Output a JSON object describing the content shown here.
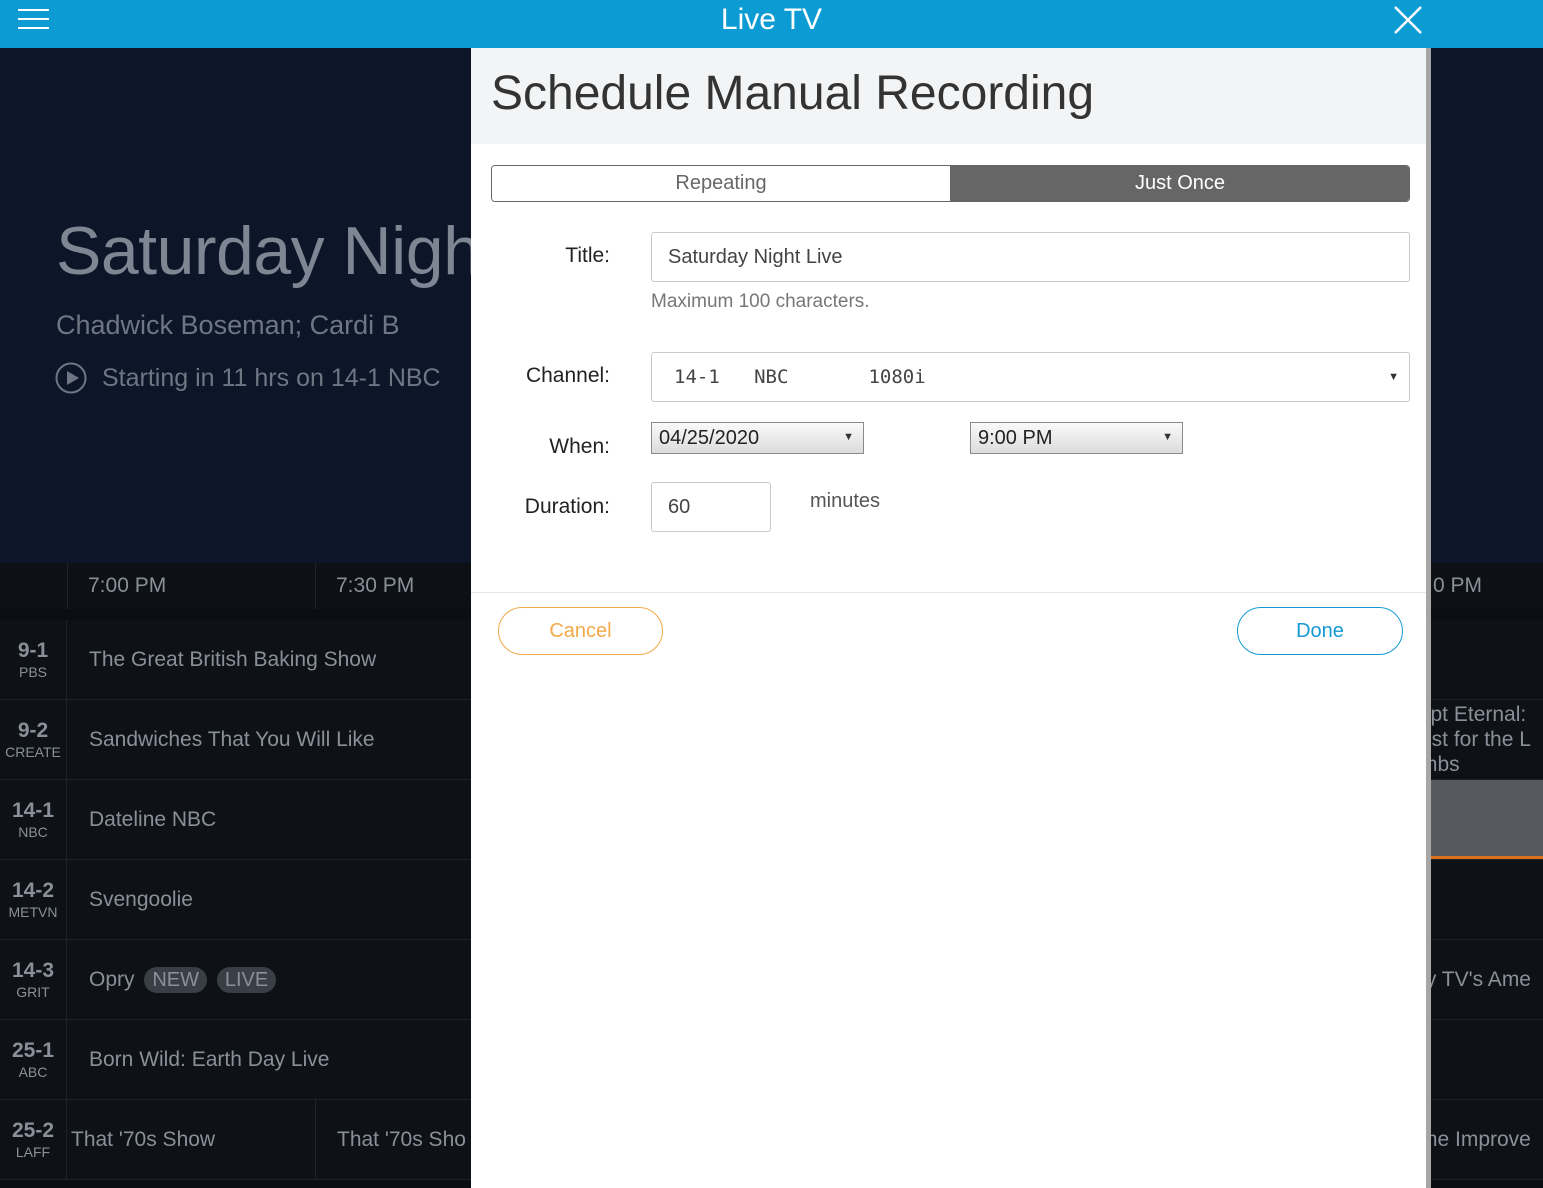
{
  "app": {
    "title": "Live TV"
  },
  "hero": {
    "title": "Saturday Nigh",
    "subtitle": "Chadwick Boseman; Cardi B",
    "status": "Starting in 11 hrs on 14-1 NBC"
  },
  "guide": {
    "times": [
      "7:00 PM",
      "7:30 PM"
    ],
    "right_time": "0 PM",
    "rows": [
      {
        "num": "9-1",
        "net": "PBS",
        "programs": [
          "The Great British Baking Show"
        ],
        "right": []
      },
      {
        "num": "9-2",
        "net": "CREATE",
        "programs": [
          "Sandwiches That You Will Like"
        ],
        "right": [
          "ypt Eternal:",
          "est for the L",
          "mbs"
        ]
      },
      {
        "num": "14-1",
        "net": "NBC",
        "programs": [
          "Dateline NBC"
        ],
        "right": [],
        "right_highlight": true
      },
      {
        "num": "14-2",
        "net": "METVN",
        "programs": [
          "Svengoolie"
        ],
        "right": []
      },
      {
        "num": "14-3",
        "net": "GRIT",
        "programs": [
          "Opry"
        ],
        "tags": [
          "NEW",
          "LIVE"
        ],
        "right": [
          "ty TV's Ame"
        ]
      },
      {
        "num": "25-1",
        "net": "ABC",
        "programs": [
          "Born Wild: Earth Day Live"
        ],
        "right": []
      },
      {
        "num": "25-2",
        "net": "LAFF",
        "programs": [
          "That '70s Show",
          "That '70s Sho"
        ],
        "right": [
          "me Improve"
        ]
      }
    ]
  },
  "modal": {
    "title": "Schedule Manual Recording",
    "segments": {
      "repeating": "Repeating",
      "once": "Just Once",
      "selected": "Just Once"
    },
    "labels": {
      "title": "Title:",
      "channel": "Channel:",
      "when": "When:",
      "duration": "Duration:"
    },
    "title_value": "Saturday Night Live",
    "title_hint": "Maximum 100 characters.",
    "channel_value": "14-1   NBC       1080i",
    "date_value": "04/25/2020",
    "time_value": "9:00 PM",
    "duration_value": "60",
    "duration_units": "minutes",
    "cancel": "Cancel",
    "done": "Done"
  },
  "colors": {
    "topbar": "#0d9bd3",
    "cancel_accent": "#f2a94a",
    "done_accent": "#1499d4",
    "selected_segment": "#666666"
  }
}
